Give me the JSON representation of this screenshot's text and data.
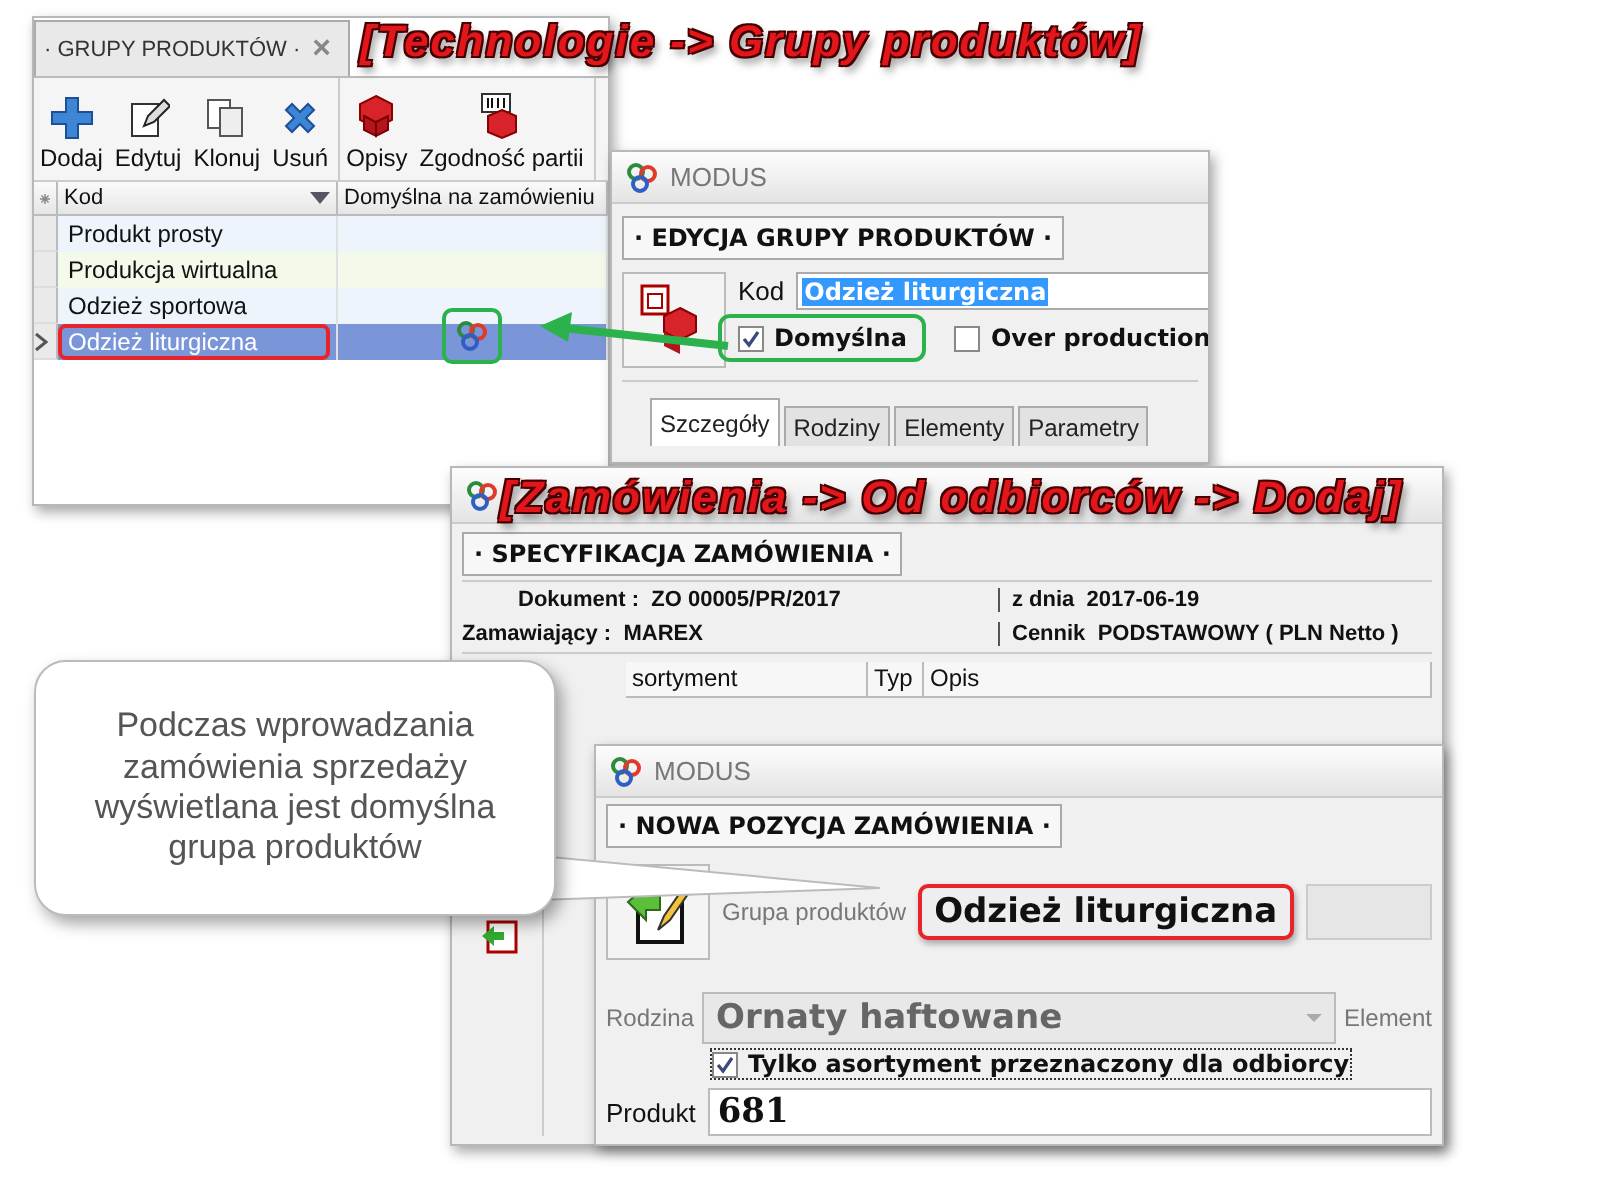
{
  "groups_window": {
    "tab": {
      "label": "· GRUPY PRODUKTÓW ·",
      "close": "×"
    },
    "toolbar": [
      {
        "label": "Dodaj",
        "kind": "plus"
      },
      {
        "label": "Edytuj",
        "kind": "pencil"
      },
      {
        "label": "Klonuj",
        "kind": "copy"
      },
      {
        "label": "Usuń",
        "kind": "delete"
      },
      {
        "label": "Opisy",
        "kind": "cubes"
      },
      {
        "label": "Zgodność partii",
        "kind": "barcode"
      }
    ],
    "columns": [
      "Kod",
      "Domyślna na zamówieniu"
    ],
    "rows": [
      {
        "kod": "Produkt prosty",
        "default": false,
        "selected": false
      },
      {
        "kod": "Produkcja wirtualna",
        "default": false,
        "selected": false
      },
      {
        "kod": "Odzież sportowa",
        "default": false,
        "selected": false
      },
      {
        "kod": "Odzież liturgiczna",
        "default": true,
        "selected": true
      }
    ]
  },
  "caption_groups": "[Technologie -> Grupy produktów]",
  "edit_window": {
    "title": "MODUS",
    "header": "· EDYCJA GRUPY PRODUKTÓW ·",
    "kod_label": "Kod",
    "kod_value": "Odzież liturgiczna",
    "checkboxes": [
      {
        "label": "Domyślna",
        "checked": true
      },
      {
        "label": "Over production",
        "checked": false
      }
    ],
    "tabs": [
      {
        "label": "Szczegóły",
        "selected": true
      },
      {
        "label": "Rodziny",
        "selected": false
      },
      {
        "label": "Elementy",
        "selected": false
      },
      {
        "label": "Parametry",
        "selected": false
      }
    ]
  },
  "order_window": {
    "caption": "[Zamówienia -> Od odbiorców -> Dodaj]",
    "header": "· SPECYFIKACJA ZAMÓWIENIA ·",
    "fields": [
      {
        "label": "Dokument :",
        "value": "ZO 00005/PR/2017"
      },
      {
        "label": "z dnia",
        "value": "2017-06-19"
      },
      {
        "label": "Zamawiający :",
        "value": "MAREX"
      },
      {
        "label": "Cennik",
        "value": "PODSTAWOWY ( PLN Netto )"
      }
    ],
    "columns": [
      "sortyment",
      "Typ",
      "Opis"
    ]
  },
  "position_window": {
    "title": "MODUS",
    "header": "· NOWA POZYCJA ZAMÓWIENIA ·",
    "group_label": "Grupa produktów",
    "group_value": "Odzież liturgiczna",
    "family_label": "Rodzina",
    "family_value": "Ornaty haftowane",
    "element_label": "Element",
    "only_customer": {
      "label": "Tylko asortyment przeznaczony dla odbiorcy",
      "checked": true
    },
    "product_label": "Produkt",
    "product_value": "681"
  },
  "callout": {
    "text": "Podczas wprowadzania zamówienia sprzedaży wyświetlana jest domyślna grupa produktów"
  }
}
